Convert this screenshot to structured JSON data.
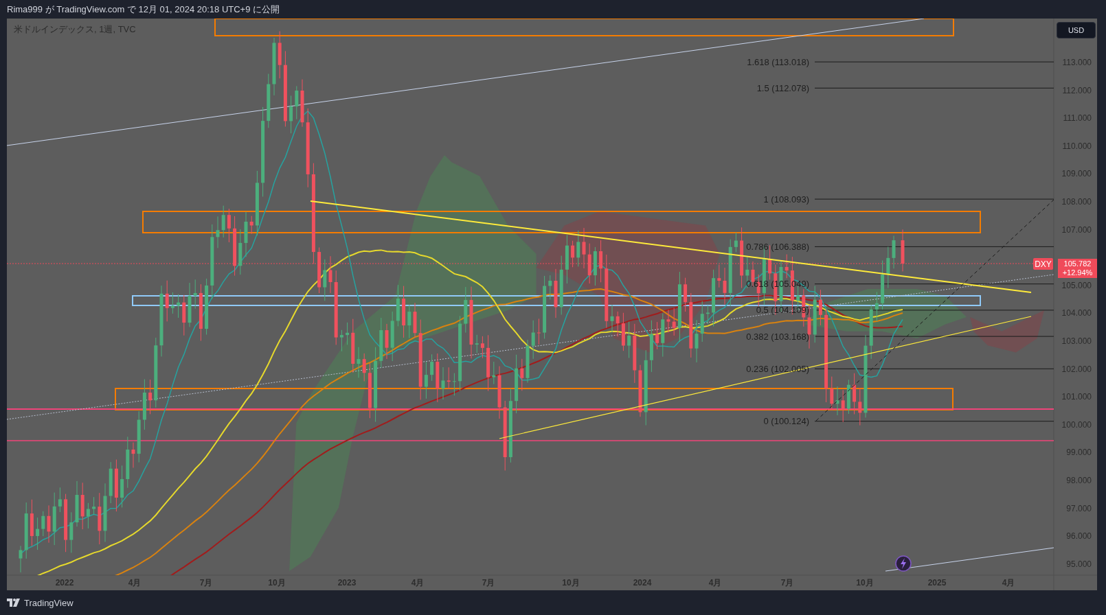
{
  "header": {
    "text": "Rima999 が TradingView.com で 12月 01, 2024 20:18 UTC+9 に公開"
  },
  "chart": {
    "legend": "米ドルインデックス, 1週, TVC",
    "currency_button": "USD",
    "symbol_tag": "DXY",
    "price_tag": {
      "price": "105.782",
      "change": "+12.94%"
    },
    "price_axis": [
      "113.000",
      "112.000",
      "111.000",
      "110.000",
      "109.000",
      "108.000",
      "107.000",
      "105.000",
      "104.000",
      "103.000",
      "102.000",
      "101.000",
      "100.000",
      "99.000",
      "98.000",
      "97.000",
      "96.000",
      "95.000"
    ],
    "time_axis": [
      "2022",
      "4月",
      "7月",
      "10月",
      "2023",
      "4月",
      "7月",
      "10月",
      "2024",
      "4月",
      "7月",
      "10月",
      "2025",
      "4月"
    ],
    "fib_levels": [
      {
        "label": "1.618 (113.018)"
      },
      {
        "label": "1.5 (112.078)"
      },
      {
        "label": "1 (108.093)"
      },
      {
        "label": "0.786 (106.388)"
      },
      {
        "label": "0.618 (105.049)"
      },
      {
        "label": "0.5 (104.109)"
      },
      {
        "label": "0.382 (103.168)"
      },
      {
        "label": "0.236 (102.005)"
      },
      {
        "label": "0 (100.124)"
      }
    ]
  },
  "footer": {
    "brand": "TradingView"
  }
}
